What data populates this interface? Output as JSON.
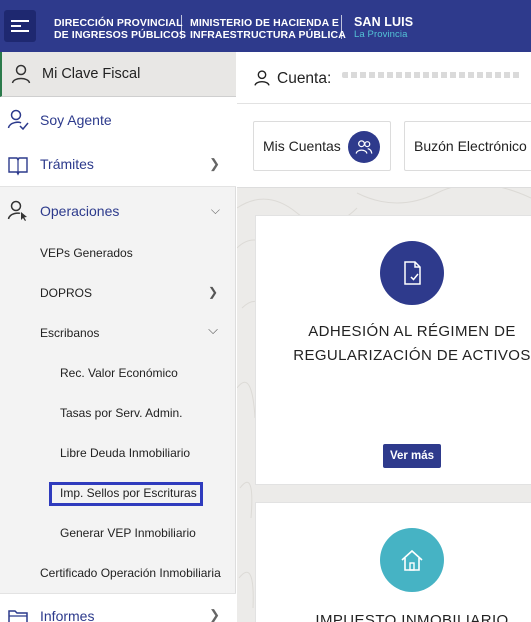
{
  "header": {
    "brand_1_line1": "DIRECCIÓN PROVINCIAL",
    "brand_1_line2": "DE INGRESOS PÚBLICOS",
    "brand_2_line1": "MINISTERIO DE HACIENDA E",
    "brand_2_line2": "INFRAESTRUCTURA PÚBLICA",
    "brand_3_line1": "SAN LUIS",
    "brand_3_line2": "La Provincia"
  },
  "sidebar": {
    "top_label": "Mi Clave Fiscal",
    "items": [
      {
        "label": "Soy Agente"
      },
      {
        "label": "Trámites"
      },
      {
        "label": "Operaciones"
      }
    ],
    "operaciones_sub": [
      {
        "label": "VEPs Generados"
      },
      {
        "label": "DOPROS"
      },
      {
        "label": "Escribanos"
      },
      {
        "label": "Rec. Valor Económico"
      },
      {
        "label": "Tasas por Serv. Admin."
      },
      {
        "label": "Libre Deuda Inmobiliario"
      },
      {
        "label": "Imp. Sellos por Escrituras"
      },
      {
        "label": "Generar VEP Inmobiliario"
      },
      {
        "label": "Certificado Operación Inmobiliaria"
      }
    ],
    "informes_label": "Informes"
  },
  "topbar": {
    "cuenta_label": "Cuenta:"
  },
  "quick": {
    "mis_cuentas": "Mis Cuentas",
    "buzon": "Buzón Electrónico"
  },
  "cards": [
    {
      "title_line1": "ADHESIÓN AL RÉGIMEN DE",
      "title_line2": "REGULARIZACIÓN DE ACTIVOS",
      "button": "Ver más"
    },
    {
      "title_line1": "IMPUESTO INMOBILIARIO"
    }
  ],
  "colors": {
    "header_bg": "#2e3a8c",
    "accent_teal": "#46b3c4",
    "highlight_border": "#2f3bbd"
  }
}
